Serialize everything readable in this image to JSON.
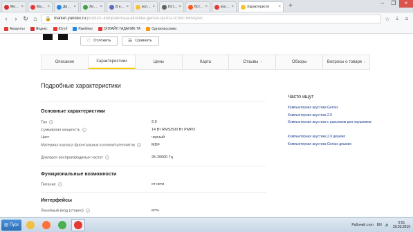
{
  "browser": {
    "tabs": [
      {
        "title": "Меню",
        "color": "#d32f2f",
        "active": false
      },
      {
        "title": "Майнкрафт",
        "color": "#e53935",
        "active": false
      },
      {
        "title": "Диалоги",
        "color": "#1e88e5",
        "active": false
      },
      {
        "title": "Личный каб",
        "color": "#43a047",
        "active": false
      },
      {
        "title": "В новых тех",
        "color": "#5c6bc0",
        "active": false
      },
      {
        "title": "колонки коп",
        "color": "#fbc02d",
        "active": false
      },
      {
        "title": "История",
        "color": "#616161",
        "active": false
      },
      {
        "title": "Встречи",
        "color": "#ff5722",
        "active": false
      },
      {
        "title": "колонки ген",
        "color": "#e53935",
        "active": false
      },
      {
        "title": "Характеристи",
        "color": "#fbc02d",
        "active": true
      }
    ],
    "tab_close": "×",
    "new_tab": "+",
    "window_controls": [
      "–",
      "❐",
      "×"
    ],
    "url_host": "market.yandex.ru",
    "url_rest": "/product--komputernaia-akustika-genius-sp-hf2-0/1587565/spec",
    "bookmarks": [
      {
        "label": "Аккаунты",
        "color": "#e53935"
      },
      {
        "label": "Яндекс",
        "color": "#d32f2f"
      },
      {
        "label": "Ютуб",
        "color": "#e53935"
      },
      {
        "label": "Рамблер",
        "color": "#1e88e5"
      },
      {
        "label": "ОНЛАЙН ГАДАНИЕ ТА",
        "color": "#e53935"
      },
      {
        "label": "Одноклассники",
        "color": "#ff9800"
      }
    ]
  },
  "product": {
    "postpone_label": "Отложить",
    "compare_label": "Сравнить",
    "tabs": [
      "Описание",
      "Характеристики",
      "Цены",
      "Карта",
      "Отзывы",
      "Обзоры",
      "Вопросы о товаре"
    ],
    "active_tab": 1,
    "tab_arrows": {
      "4": "›",
      "6": "›"
    }
  },
  "specs": {
    "heading": "Подробные характеристики",
    "sections": [
      {
        "title": "Основные характеристики",
        "rows": [
          {
            "key": "Тип",
            "help": true,
            "value": "2.0"
          },
          {
            "key": "Суммарная мощность",
            "help": true,
            "value": "14 Вт RMS/500 Вт PMPO"
          },
          {
            "key": "Цвет",
            "help": false,
            "value": "черный"
          },
          {
            "key": "Материал корпуса фронтальных колонок/сателлитов",
            "help": true,
            "value": "MDF"
          },
          {
            "key": "Диапазон воспроизводимых частот",
            "help": true,
            "value": "25-20000 Гц"
          }
        ]
      },
      {
        "title": "Функциональные возможности",
        "rows": [
          {
            "key": "Питание",
            "help": true,
            "value": "от сети"
          }
        ]
      },
      {
        "title": "Интерфейсы",
        "rows": [
          {
            "key": "Линейный вход (стерео)",
            "help": true,
            "value": "есть"
          }
        ]
      }
    ]
  },
  "sidebar": {
    "title": "Часто ищут",
    "links": [
      "Компьютерная акустика Genius",
      "Компьютерная акустика 2.0",
      "Компьютерная акустика с разъемом для наушников",
      "Компьютерная акустика 2.0 дешево",
      "Компьютерная акустика Genius дешево"
    ]
  },
  "taskbar": {
    "start_label": "Пуск",
    "apps": [
      {
        "name": "explorer",
        "color": "#f0c040"
      },
      {
        "name": "firefox",
        "color": "#ff7139"
      },
      {
        "name": "chrome",
        "color": "#4caf50"
      },
      {
        "name": "opera",
        "color": "#e53935",
        "active": true
      }
    ],
    "desktop_label": "Рабочий стол",
    "lang": "EN",
    "time": "0:51",
    "date": "20.03.2019"
  }
}
